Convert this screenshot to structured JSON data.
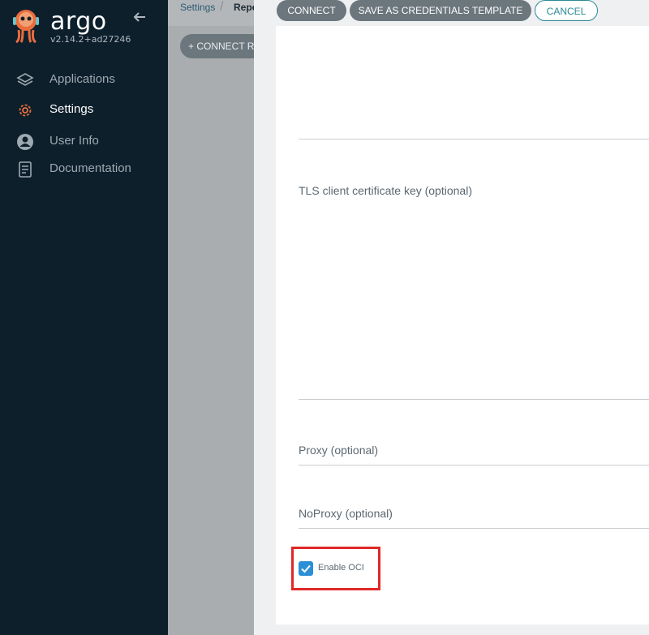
{
  "sidebar": {
    "brand": "argo",
    "version": "v2.14.2+ad27246",
    "items": [
      {
        "label": "Applications",
        "icon": "layers-icon"
      },
      {
        "label": "Settings",
        "icon": "gear-icon"
      },
      {
        "label": "User Info",
        "icon": "user-icon"
      },
      {
        "label": "Documentation",
        "icon": "book-icon"
      }
    ]
  },
  "breadcrumb": {
    "first": "Settings",
    "second": "Repo"
  },
  "toolbar": {
    "connect_repo": "+ CONNECT R"
  },
  "panel": {
    "buttons": {
      "connect": "CONNECT",
      "save_template": "SAVE AS CREDENTIALS TEMPLATE",
      "cancel": "CANCEL"
    },
    "fields": {
      "tls_key_label": "TLS client certificate key (optional)",
      "proxy_label": "Proxy (optional)",
      "noproxy_label": "NoProxy (optional)"
    },
    "enable_oci": {
      "label": "Enable OCI",
      "checked": true
    }
  },
  "colors": {
    "sidebar_bg": "#0d1f2b",
    "accent": "#2d8a96",
    "checkbox": "#2b8fd6",
    "highlight": "#e02828"
  }
}
